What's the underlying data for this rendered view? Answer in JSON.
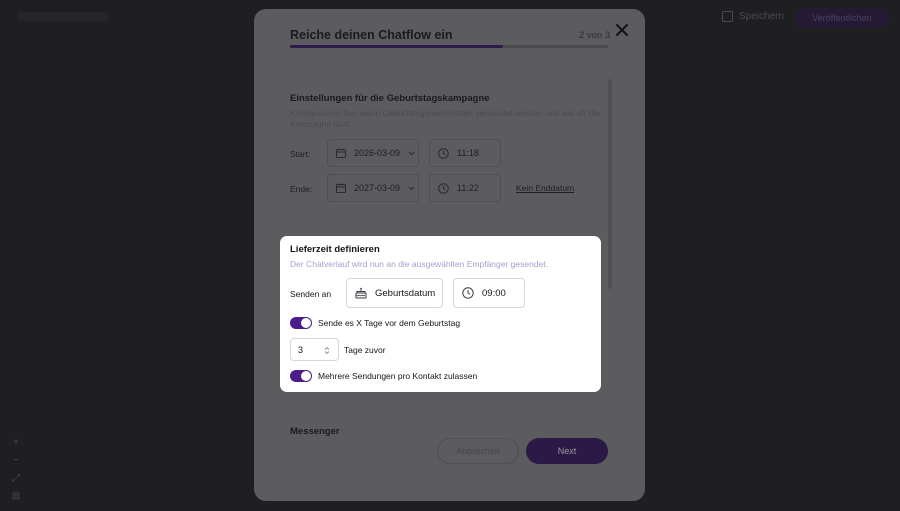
{
  "background": {
    "save_label": "Speichern",
    "publish_label": "Veröffentlichen",
    "tools": [
      "+",
      "−",
      "⤢",
      "⊞"
    ]
  },
  "modal": {
    "title": "Reiche deinen Chatflow ein",
    "step": "2 von 3",
    "progress_fraction": 0.67,
    "campaign": {
      "title": "Einstellungen für die Geburtstagskampagne",
      "description": "Konfigurieren Sie, wann Geburtstagsnachrichten versendet werden und wie oft die Kampagne läuft.",
      "start_label": "Start:",
      "start_date": "2026-03-09",
      "start_time": "11:18",
      "end_label": "Ende:",
      "end_date": "2027-03-09",
      "end_time": "11:22",
      "no_end_date_link": "Kein Enddatum"
    },
    "messenger_title": "Messenger",
    "cancel_label": "Abbrechen",
    "next_label": "Next"
  },
  "delivery": {
    "title": "Lieferzeit definieren",
    "description": "Der Chatverlauf wird nun an die ausgewählten Empfänger gesendet.",
    "send_to_label": "Senden an",
    "send_to_value": "Geburtsdatum",
    "time_value": "09:00",
    "toggle_days_before_label": "Sende es X Tage vor dem Geburtstag",
    "toggle_days_before_on": true,
    "days_value": "3",
    "days_suffix": "Tage zuvor",
    "toggle_multiple_label": "Mehrere Sendungen pro Kontakt zulassen",
    "toggle_multiple_on": true
  },
  "colors": {
    "accent": "#4b1d8c",
    "overlay": "#1f1f21",
    "hint_text": "#a39fd0"
  }
}
